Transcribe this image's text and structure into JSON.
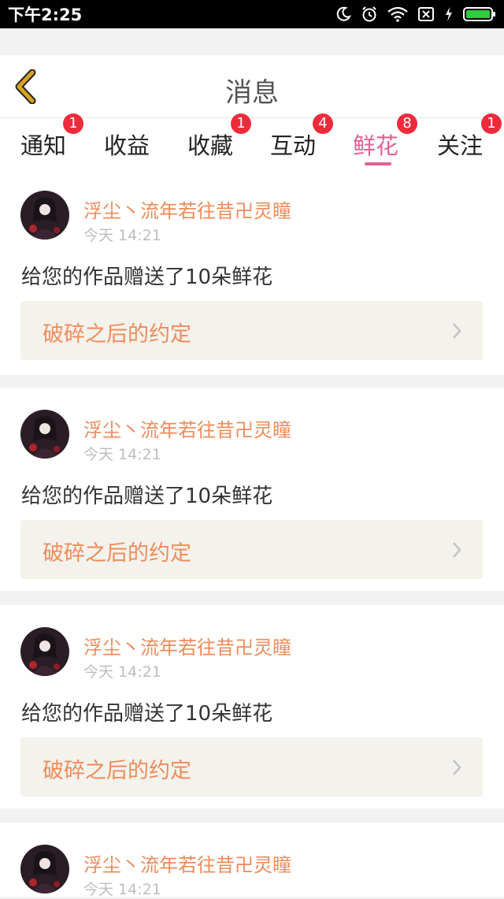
{
  "status_bar": {
    "time": "下午2:25",
    "icons": [
      "moon-icon",
      "alarm-icon",
      "wifi-icon",
      "no-sim-icon",
      "charging-icon",
      "battery-icon"
    ],
    "battery_color": "#2ecc40"
  },
  "header": {
    "title": "消息",
    "back_icon": "chevron-left-icon",
    "back_icon_color": "#d9a321"
  },
  "tabs": [
    {
      "label": "通知",
      "badge": "1",
      "active": false
    },
    {
      "label": "收益",
      "badge": "",
      "active": false
    },
    {
      "label": "收藏",
      "badge": "1",
      "active": false
    },
    {
      "label": "互动",
      "badge": "4",
      "active": false
    },
    {
      "label": "鲜花",
      "badge": "8",
      "active": true
    },
    {
      "label": "关注",
      "badge": "1",
      "active": false
    }
  ],
  "colors": {
    "accent": "#e65f96",
    "badge": "#ee2b3b",
    "username": "#ef8b5a"
  },
  "messages": [
    {
      "user": "浮尘丶流年若往昔卍灵瞳",
      "time": "今天 14:21",
      "text": "给您的作品赠送了10朵鲜花",
      "work_title": "破碎之后的约定"
    },
    {
      "user": "浮尘丶流年若往昔卍灵瞳",
      "time": "今天 14:21",
      "text": "给您的作品赠送了10朵鲜花",
      "work_title": "破碎之后的约定"
    },
    {
      "user": "浮尘丶流年若往昔卍灵瞳",
      "time": "今天 14:21",
      "text": "给您的作品赠送了10朵鲜花",
      "work_title": "破碎之后的约定"
    },
    {
      "user": "浮尘丶流年若往昔卍灵瞳",
      "time": "今天 14:21",
      "text": "",
      "work_title": ""
    }
  ]
}
